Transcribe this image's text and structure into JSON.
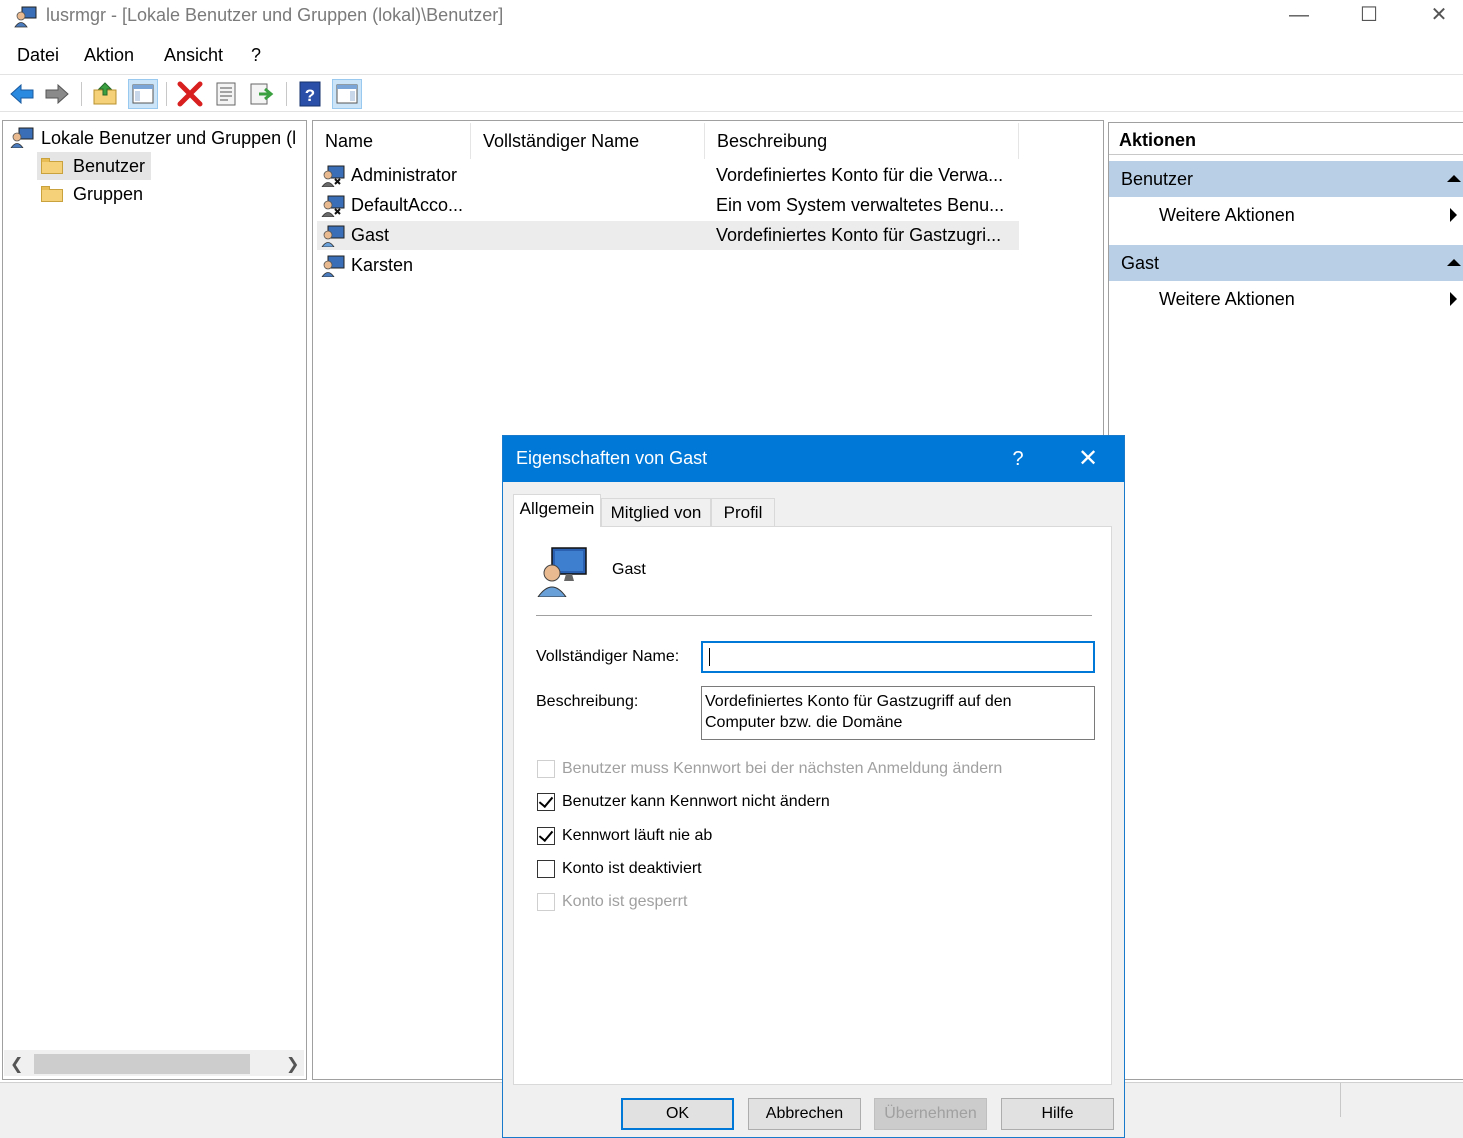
{
  "window": {
    "title": "lusrmgr - [Lokale Benutzer und Gruppen (lokal)\\Benutzer]",
    "minimize": "—",
    "maximize": "☐",
    "close": "✕"
  },
  "menu": [
    "Datei",
    "Aktion",
    "Ansicht",
    "?"
  ],
  "toolbar": {
    "icons": [
      "back-arrow-icon",
      "forward-arrow-icon",
      "up-folder-icon",
      "show-hide-tree-icon",
      "delete-icon",
      "properties-icon",
      "export-list-icon",
      "help-icon",
      "show-action-pane-icon"
    ]
  },
  "tree": {
    "root": "Lokale Benutzer und Gruppen (l",
    "items": [
      "Benutzer",
      "Gruppen"
    ],
    "selected": "Benutzer"
  },
  "list": {
    "columns": [
      "Name",
      "Vollständiger Name",
      "Beschreibung"
    ],
    "rows": [
      {
        "name": "Administrator",
        "full_name": "",
        "description": "Vordefiniertes Konto für die Verwa..."
      },
      {
        "name": "DefaultAcco...",
        "full_name": "",
        "description": "Ein vom System verwaltetes Benu..."
      },
      {
        "name": "Gast",
        "full_name": "",
        "description": "Vordefiniertes Konto für Gastzugri..."
      },
      {
        "name": "Karsten",
        "full_name": "",
        "description": ""
      }
    ],
    "selected_index": 2
  },
  "actions": {
    "header": "Aktionen",
    "sections": [
      {
        "title": "Benutzer",
        "item": "Weitere Aktionen"
      },
      {
        "title": "Gast",
        "item": "Weitere Aktionen"
      }
    ]
  },
  "dialog": {
    "title": "Eigenschaften von Gast",
    "help": "?",
    "close": "✕",
    "tabs": [
      "Allgemein",
      "Mitglied von",
      "Profil"
    ],
    "active_tab": "Allgemein",
    "user_name": "Gast",
    "full_name_label": "Vollständiger Name:",
    "full_name_value": "",
    "description_label": "Beschreibung:",
    "description_value": "Vordefiniertes Konto für Gastzugriff auf den Computer bzw. die Domäne",
    "checkboxes": [
      {
        "label": "Benutzer muss Kennwort bei der nächsten Anmeldung ändern",
        "checked": false,
        "enabled": false
      },
      {
        "label": "Benutzer kann Kennwort nicht ändern",
        "checked": true,
        "enabled": true
      },
      {
        "label": "Kennwort läuft nie ab",
        "checked": true,
        "enabled": true
      },
      {
        "label": "Konto ist deaktiviert",
        "checked": false,
        "enabled": true
      },
      {
        "label": "Konto ist gesperrt",
        "checked": false,
        "enabled": false
      }
    ],
    "buttons": {
      "ok": "OK",
      "cancel": "Abbrechen",
      "apply": "Übernehmen",
      "help": "Hilfe"
    }
  },
  "colors": {
    "dialog_title_bg": "#0078d7",
    "action_section_bg": "#b8cfe6",
    "selection_bg": "#e5e5e5"
  }
}
